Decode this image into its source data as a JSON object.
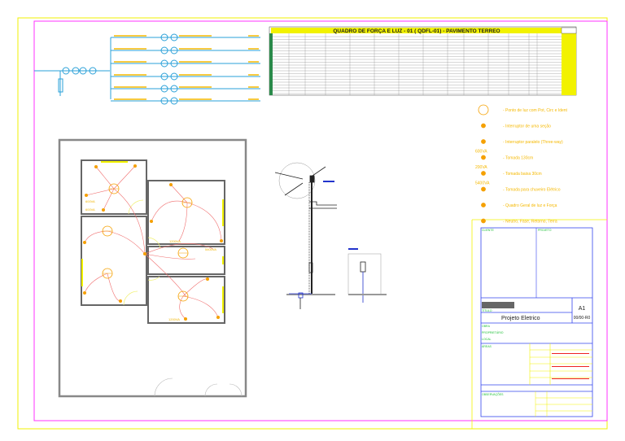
{
  "sheet": {
    "format": "A1",
    "revision": "00/00-R0",
    "project_title": "Projeto Eletrico"
  },
  "panel_table": {
    "title": "QUADRO DE FORÇA E LUZ - 01 ( QDFL-01) - PAVIMENTO TERREO"
  },
  "legend": [
    {
      "icon": "light-point-icon",
      "power": "",
      "label": "- Ponto de luz com Pot, Circ e Ident"
    },
    {
      "icon": "single-switch-icon",
      "power": "",
      "label": "- Interruptor de uma seção"
    },
    {
      "icon": "three-way-switch-icon",
      "power": "",
      "label": "- Interruptor paralelo (Three-way)"
    },
    {
      "icon": "outlet-high-icon",
      "power": "600VA",
      "label": "- Tomada 130cm"
    },
    {
      "icon": "outlet-low-icon",
      "power": "200VA",
      "label": "- Tomada baixa 30cm"
    },
    {
      "icon": "shower-outlet-icon",
      "power": "5400VA",
      "label": "- Tomada para chuveiro Elétrico"
    },
    {
      "icon": "panel-board-icon",
      "power": "",
      "label": "- Quadro Geral de luz e Força"
    },
    {
      "icon": "wiring-icon",
      "power": "",
      "label": "- Neutro, Fase, Retorno, Terra"
    }
  ],
  "plan_labels": {
    "room_power_1": "600VA",
    "room_power_2": "600VA",
    "bath_power": "5400VA",
    "kitchen_power": "1200VA",
    "room_power_3": "1200VA"
  },
  "colors": {
    "frame_outer": "#f2f200",
    "frame_inner": "#ff33ff",
    "wiring": "#f07070",
    "symbols": "#f5a000",
    "diagram": "#2aa0d8",
    "title_block": "#3344ee",
    "table_header": "#f2f200"
  }
}
